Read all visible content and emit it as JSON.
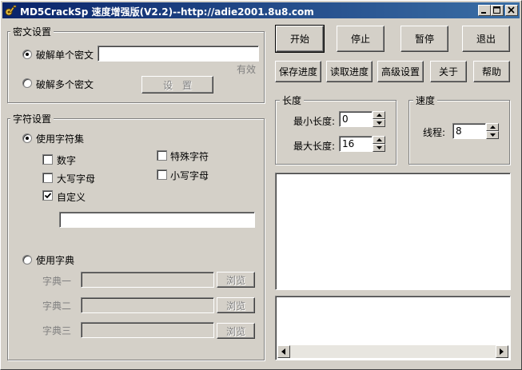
{
  "window": {
    "title": "MD5CrackSp 速度增强版(V2.2)--http://adie2001.8u8.com"
  },
  "toolbar": {
    "start": "开始",
    "stop": "停止",
    "pause": "暂停",
    "exit": "退出",
    "save_progress": "保存进度",
    "read_progress": "读取进度",
    "advanced": "高级设置",
    "about": "关于",
    "help": "帮助"
  },
  "cipher": {
    "group_label": "密文设置",
    "single_label": "破解单个密文",
    "single_value": "",
    "valid_label": "有效",
    "multi_label": "破解多个密文",
    "settings_button": "设　置"
  },
  "charset": {
    "group_label": "字符设置",
    "use_charset_label": "使用字符集",
    "digits_label": "数字",
    "upper_label": "大写字母",
    "custom_label": "自定义",
    "special_label": "特殊字符",
    "lower_label": "小写字母",
    "custom_value": "",
    "use_dict_label": "使用字典",
    "dict1_label": "字典一",
    "dict2_label": "字典二",
    "dict3_label": "字典三",
    "browse_label": "浏览"
  },
  "length": {
    "group_label": "长度",
    "min_label": "最小长度:",
    "min_value": "0",
    "max_label": "最大长度:",
    "max_value": "16"
  },
  "speed": {
    "group_label": "速度",
    "threads_label": "线程:",
    "threads_value": "8"
  },
  "state": {
    "single_selected": true,
    "use_charset_selected": true,
    "digits_checked": false,
    "upper_checked": false,
    "custom_checked": true,
    "special_checked": false,
    "lower_checked": false
  },
  "icons": {
    "app": "app-key-icon",
    "minimize": "minimize-icon",
    "maximize": "maximize-icon",
    "close": "close-icon"
  }
}
